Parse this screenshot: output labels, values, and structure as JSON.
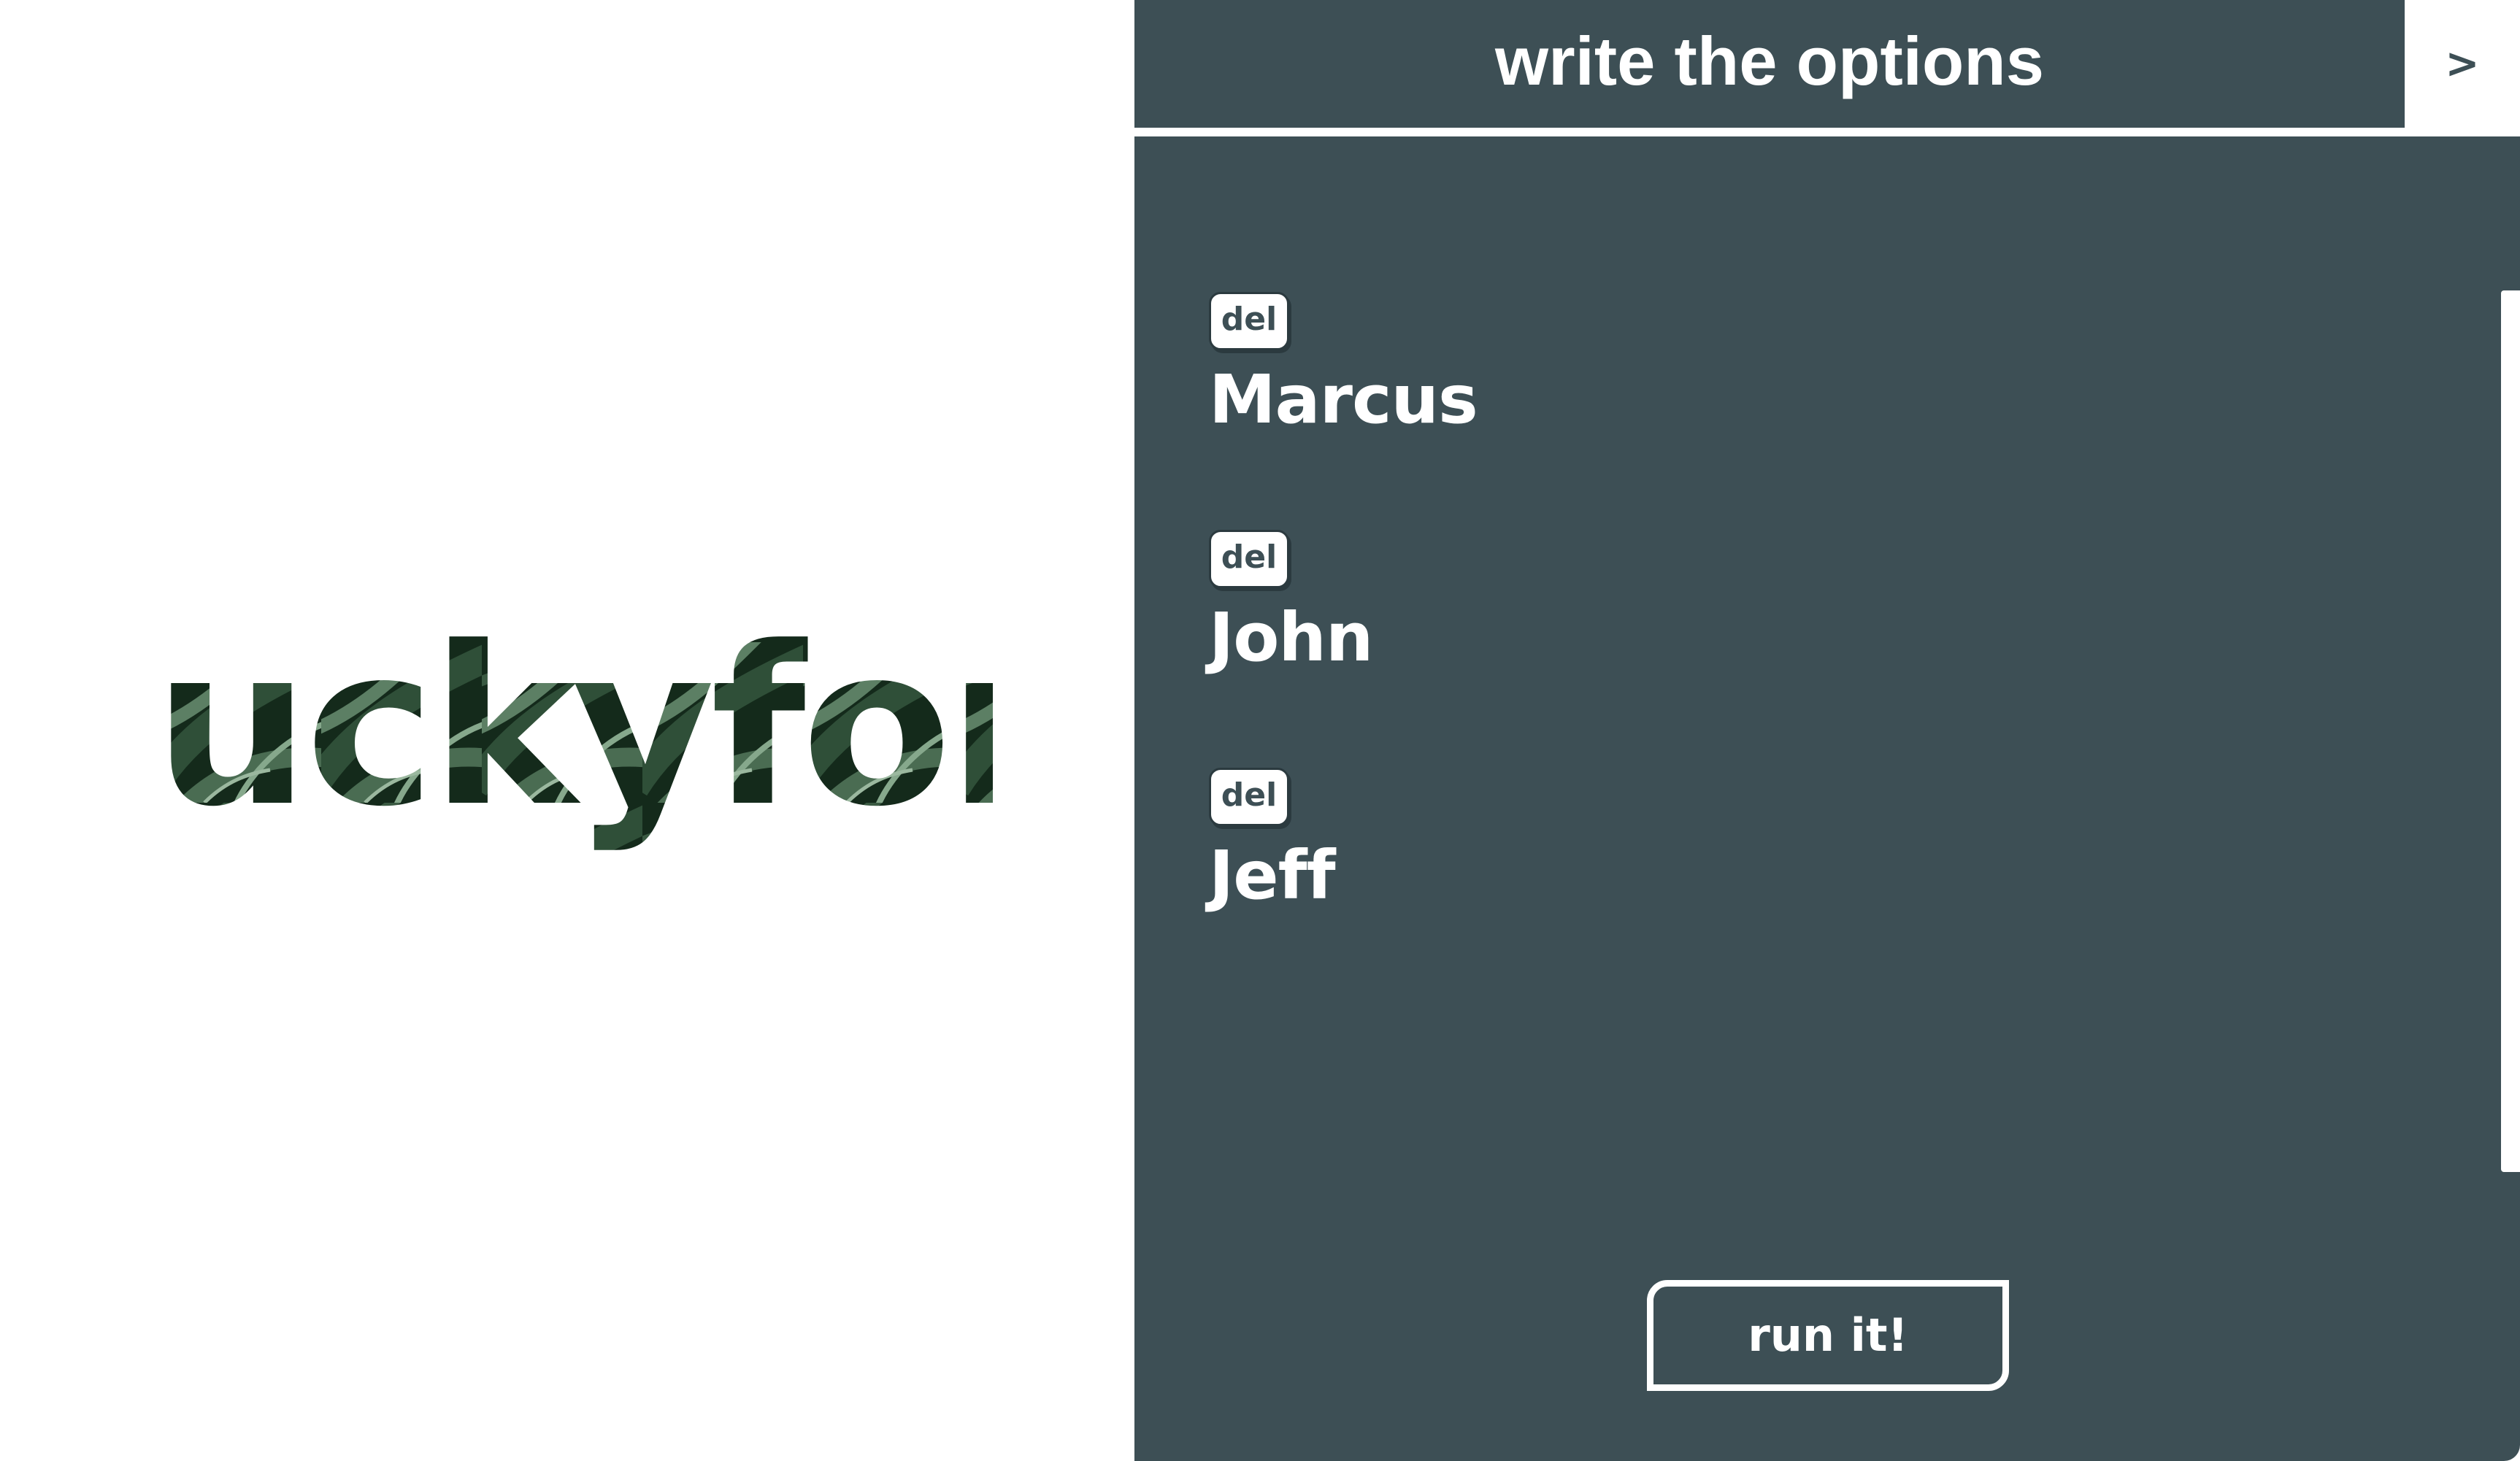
{
  "logo": {
    "text": "luckyfor",
    "texture": "leaf-texture",
    "colors": [
      "#0f1f15",
      "#1f3a26",
      "#3d6147",
      "#6f9277"
    ]
  },
  "header": {
    "title": "write the options",
    "toggle_label": ">"
  },
  "options": {
    "items": [
      {
        "delete_label": "del",
        "label": "Marcus"
      },
      {
        "delete_label": "del",
        "label": "John"
      },
      {
        "delete_label": "del",
        "label": "Jeff"
      }
    ]
  },
  "actions": {
    "run_label": "run it!"
  },
  "colors": {
    "panel": "#3d4f55",
    "text_light": "#ffffff",
    "background": "#ffffff"
  }
}
